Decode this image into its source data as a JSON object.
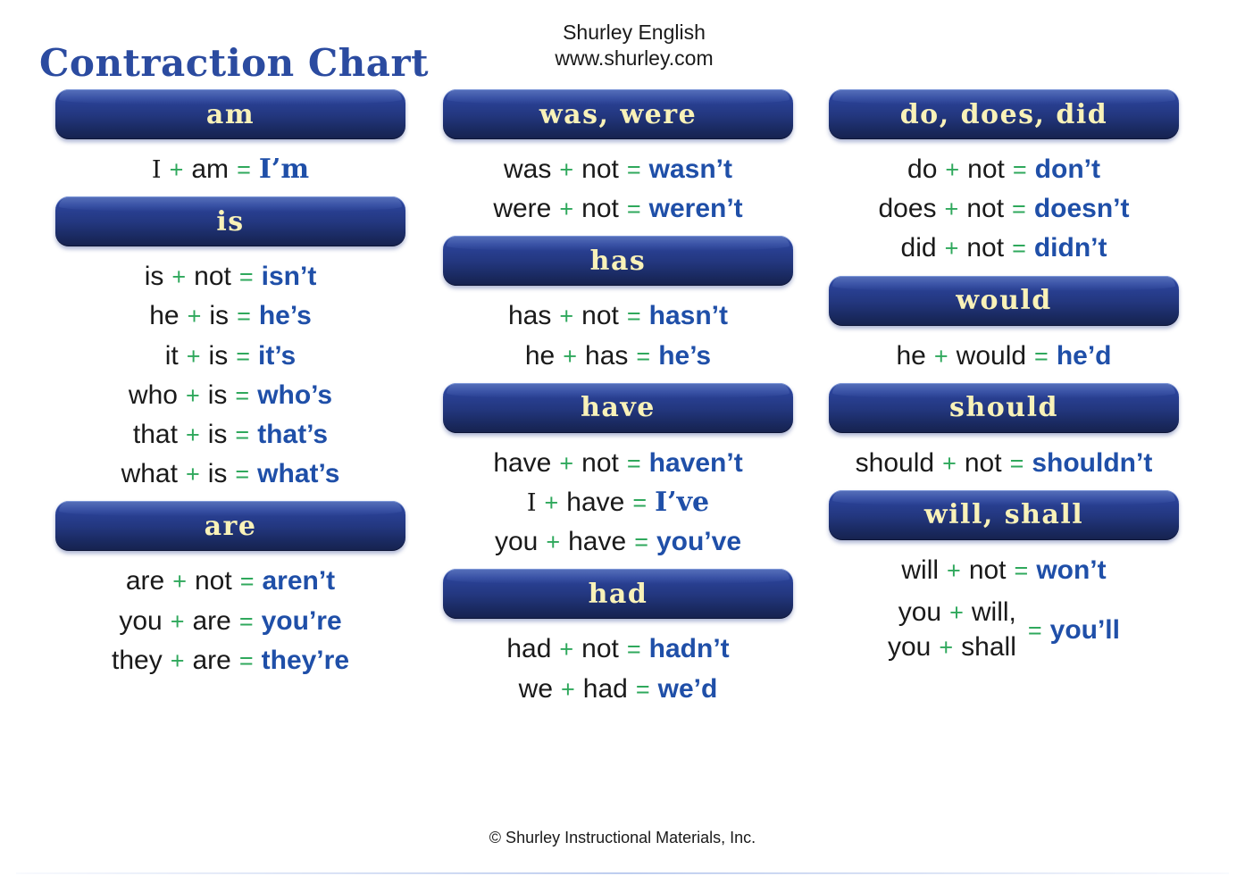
{
  "title": "Contraction Chart",
  "brand": {
    "name": "Shurley English",
    "website": "www.shurley.com"
  },
  "colors": {
    "title_blue": "#2b4ba0",
    "pill_top": "#37509f",
    "pill_bottom": "#16224e",
    "pill_label_cream": "#f9f2b8",
    "operator_green": "#2fa85c",
    "result_blue": "#1f4fa8",
    "word_black": "#1a1a1a",
    "background": "#ffffff"
  },
  "footer": {
    "copyright": "© Shurley Instructional Materials, Inc."
  },
  "columns": [
    {
      "id": "column-1",
      "sections": [
        {
          "heading": "am",
          "rows": [
            {
              "left": "I",
              "op1": "+",
              "right": "am",
              "op2": "=",
              "result": "I’m",
              "left_serif": true,
              "result_serif": true
            }
          ]
        },
        {
          "heading": "is",
          "rows": [
            {
              "left": "is",
              "op1": "+",
              "right": "not",
              "op2": "=",
              "result": "isn’t"
            },
            {
              "left": "he",
              "op1": "+",
              "right": "is",
              "op2": "=",
              "result": "he’s"
            },
            {
              "left": "it",
              "op1": "+",
              "right": "is",
              "op2": "=",
              "result": "it’s"
            },
            {
              "left": "who",
              "op1": "+",
              "right": "is",
              "op2": "=",
              "result": "who’s"
            },
            {
              "left": "that",
              "op1": "+",
              "right": "is",
              "op2": "=",
              "result": "that’s"
            },
            {
              "left": "what",
              "op1": "+",
              "right": "is",
              "op2": "=",
              "result": "what’s"
            }
          ]
        },
        {
          "heading": "are",
          "rows": [
            {
              "left": "are",
              "op1": "+",
              "right": "not",
              "op2": "=",
              "result": "aren’t"
            },
            {
              "left": "you",
              "op1": "+",
              "right": "are",
              "op2": "=",
              "result": "you’re"
            },
            {
              "left": "they",
              "op1": "+",
              "right": "are",
              "op2": "=",
              "result": "they’re"
            }
          ]
        }
      ]
    },
    {
      "id": "column-2",
      "sections": [
        {
          "heading": "was, were",
          "rows": [
            {
              "left": "was",
              "op1": "+",
              "right": "not",
              "op2": "=",
              "result": "wasn’t"
            },
            {
              "left": "were",
              "op1": "+",
              "right": "not",
              "op2": "=",
              "result": "weren’t"
            }
          ]
        },
        {
          "heading": "has",
          "rows": [
            {
              "left": "has",
              "op1": "+",
              "right": "not",
              "op2": "=",
              "result": "hasn’t"
            },
            {
              "left": "he",
              "op1": "+",
              "right": "has",
              "op2": "=",
              "result": "he’s"
            }
          ]
        },
        {
          "heading": "have",
          "rows": [
            {
              "left": "have",
              "op1": "+",
              "right": "not",
              "op2": "=",
              "result": "haven’t"
            },
            {
              "left": "I",
              "op1": "+",
              "right": "have",
              "op2": "=",
              "result": "I’ve",
              "left_serif": true,
              "result_serif": true
            },
            {
              "left": "you",
              "op1": "+",
              "right": "have",
              "op2": "=",
              "result": "you’ve"
            }
          ]
        },
        {
          "heading": "had",
          "rows": [
            {
              "left": "had",
              "op1": "+",
              "right": "not",
              "op2": "=",
              "result": "hadn’t"
            },
            {
              "left": "we",
              "op1": "+",
              "right": "had",
              "op2": "=",
              "result": "we’d"
            }
          ]
        }
      ]
    },
    {
      "id": "column-3",
      "sections": [
        {
          "heading": "do, does, did",
          "rows": [
            {
              "left": "do",
              "op1": "+",
              "right": "not",
              "op2": "=",
              "result": "don’t"
            },
            {
              "left": "does",
              "op1": "+",
              "right": "not",
              "op2": "=",
              "result": "doesn’t"
            },
            {
              "left": "did",
              "op1": "+",
              "right": "not",
              "op2": "=",
              "result": "didn’t"
            }
          ]
        },
        {
          "heading": "would",
          "rows": [
            {
              "left": "he",
              "op1": "+",
              "right": "would",
              "op2": "=",
              "result": "he’d"
            }
          ]
        },
        {
          "heading": "should",
          "rows": [
            {
              "left": "should",
              "op1": "+",
              "right": "not",
              "op2": "=",
              "result": "shouldn’t"
            }
          ]
        },
        {
          "heading": "will, shall",
          "rows": [
            {
              "left": "will",
              "op1": "+",
              "right": "not",
              "op2": "=",
              "result": "won’t"
            },
            {
              "stacked": true,
              "lines": [
                {
                  "left": "you",
                  "op1": "+",
                  "right": "will,"
                },
                {
                  "left": "you",
                  "op1": "+",
                  "right": "shall"
                }
              ],
              "op2": "=",
              "result": "you’ll"
            }
          ]
        }
      ]
    }
  ]
}
